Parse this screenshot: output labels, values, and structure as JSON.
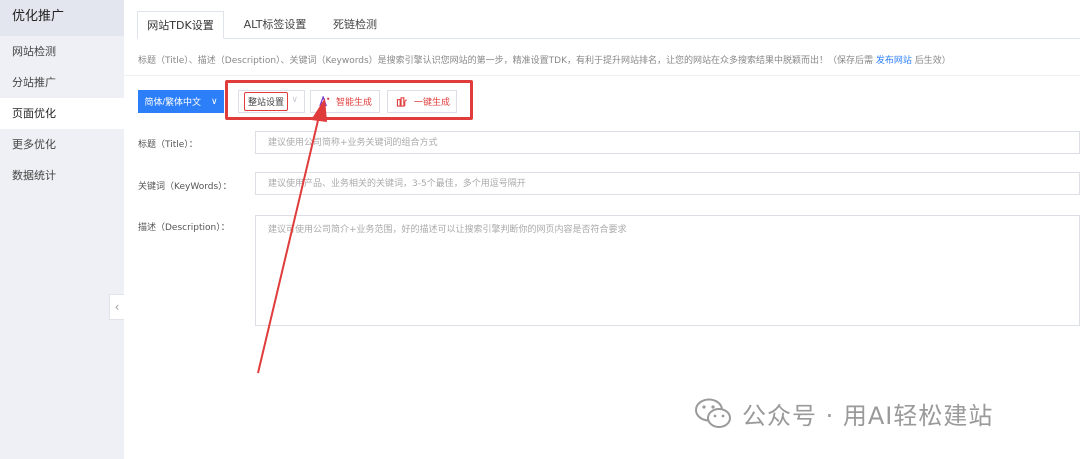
{
  "sidebar": {
    "title": "优化推广",
    "items": [
      {
        "label": "网站检测"
      },
      {
        "label": "分站推广"
      },
      {
        "label": "页面优化"
      },
      {
        "label": "更多优化"
      },
      {
        "label": "数据统计"
      }
    ],
    "active_index": 2
  },
  "tabs": [
    {
      "label": "网站TDK设置"
    },
    {
      "label": "ALT标签设置"
    },
    {
      "label": "死链检测"
    }
  ],
  "tip": {
    "text": "标题（Title）、描述（Description）、关键词（Keywords）是搜索引擎认识您网站的第一步，精准设置TDK，有利于提升网站排名，让您的网站在众多搜索结果中脱颖而出！（保存后需",
    "link": "发布网站",
    "suffix": "后生效）"
  },
  "toolbar": {
    "language": "简体/繁体中文",
    "site_settings": "整站设置",
    "smart_generate": "智能生成",
    "one_click_generate": "一键生成"
  },
  "form": {
    "title_label": "标题（Title）：",
    "title_placeholder": "建议使用公司简称+业务关键词的组合方式",
    "keywords_label": "关键词（KeyWords）：",
    "keywords_placeholder": "建议使用产品、业务相关的关键词，3-5个最佳，多个用逗号隔开",
    "description_label": "描述（Description）：",
    "description_placeholder": "建议可使用公司简介+业务范围，好的描述可以让搜索引擎判断你的网页内容是否符合要求"
  },
  "watermark": {
    "text": "公众号 · 用AI轻松建站",
    "icon": "wechat-icon"
  },
  "colors": {
    "accent": "#2d7ff9",
    "highlight": "#e03c3c",
    "sidebar_bg": "#eef0f5"
  }
}
